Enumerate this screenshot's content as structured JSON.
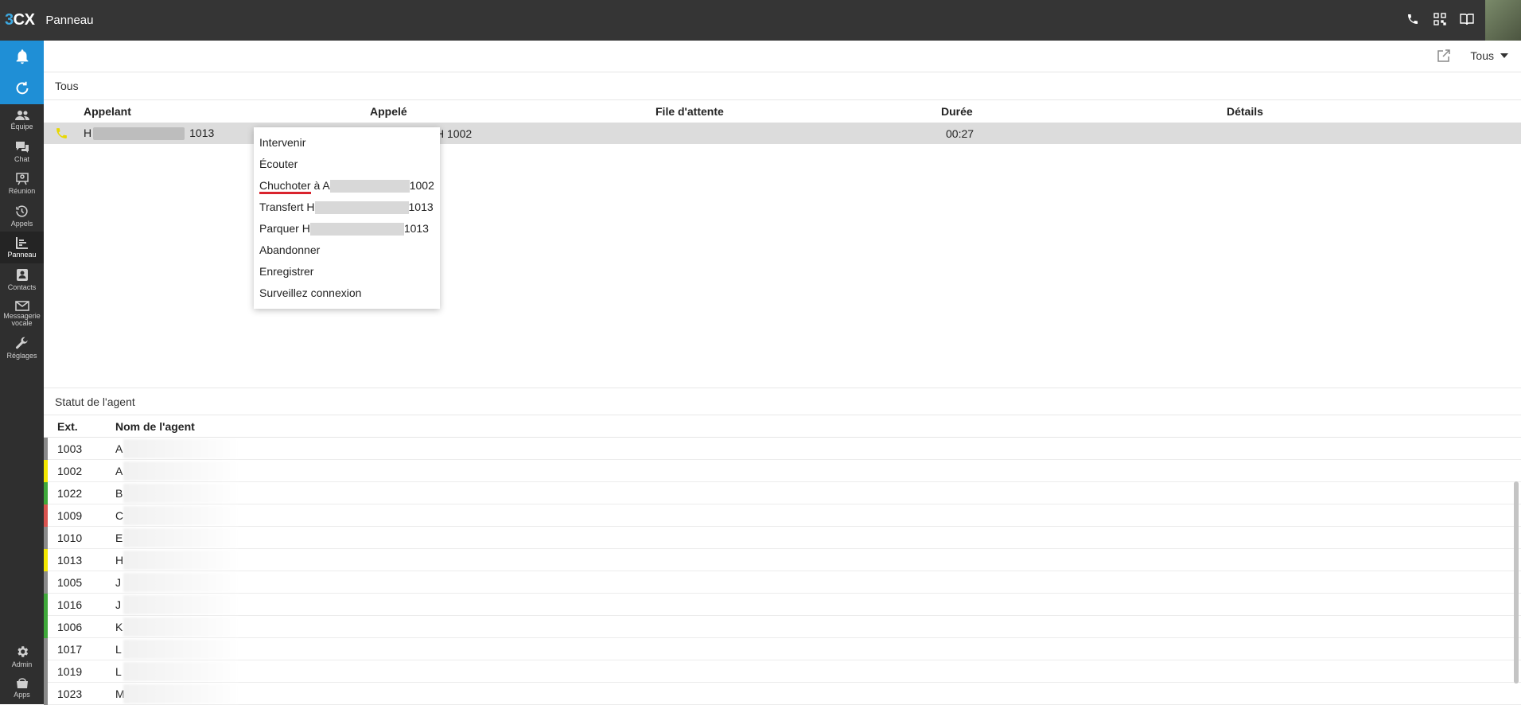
{
  "topbar": {
    "logo_digit": "3",
    "logo_text": "CX",
    "title": "Panneau"
  },
  "sidebar": {
    "items": [
      {
        "label": "Équipe"
      },
      {
        "label": "Chat"
      },
      {
        "label": "Réunion"
      },
      {
        "label": "Appels"
      },
      {
        "label": "Panneau"
      },
      {
        "label": "Contacts"
      },
      {
        "label": "Messagerie vocale"
      },
      {
        "label": "Réglages"
      }
    ],
    "bottom": [
      {
        "label": "Admin"
      },
      {
        "label": "Apps"
      }
    ]
  },
  "toolbar": {
    "filter_label": "Tous"
  },
  "calls": {
    "section_title": "Tous",
    "columns": [
      "Appelant",
      "Appelé",
      "File d'attente",
      "Durée",
      "Détails"
    ],
    "row": {
      "caller_prefix": "H",
      "caller_suffix": "1013",
      "callee_suffix": "H 1002",
      "duration": "00:27"
    }
  },
  "context_menu": {
    "items": [
      {
        "label": "Intervenir"
      },
      {
        "label": "Écouter"
      },
      {
        "label": "Chuchoter",
        "suffix_prefix": " à A",
        "suffix_ext": "1002"
      },
      {
        "label": "Transfert H",
        "suffix_ext": "1013"
      },
      {
        "label": "Parquer H",
        "suffix_ext": "1013"
      },
      {
        "label": "Abandonner"
      },
      {
        "label": "Enregistrer"
      },
      {
        "label": "Surveillez connexion"
      }
    ]
  },
  "agents": {
    "section_title": "Statut de l'agent",
    "columns": {
      "ext": "Ext.",
      "name": "Nom de l'agent"
    },
    "status_colors": {
      "gray": "#8a8a8a",
      "yellow": "#f2e600",
      "green": "#3fa83a",
      "red": "#d9534f"
    },
    "rows": [
      {
        "ext": "1003",
        "initial": "A",
        "status": "gray"
      },
      {
        "ext": "1002",
        "initial": "A",
        "status": "yellow"
      },
      {
        "ext": "1022",
        "initial": "B",
        "status": "green"
      },
      {
        "ext": "1009",
        "initial": "C",
        "status": "red"
      },
      {
        "ext": "1010",
        "initial": "E",
        "status": "gray"
      },
      {
        "ext": "1013",
        "initial": "H",
        "status": "yellow"
      },
      {
        "ext": "1005",
        "initial": "J",
        "status": "gray"
      },
      {
        "ext": "1016",
        "initial": "J",
        "status": "green"
      },
      {
        "ext": "1006",
        "initial": "K",
        "status": "green"
      },
      {
        "ext": "1017",
        "initial": "L",
        "status": "gray"
      },
      {
        "ext": "1019",
        "initial": "L",
        "status": "gray"
      },
      {
        "ext": "1023",
        "initial": "M",
        "status": "gray"
      }
    ]
  }
}
